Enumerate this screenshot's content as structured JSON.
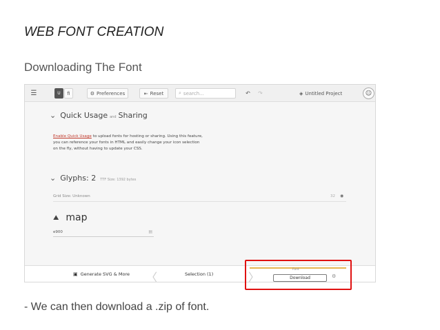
{
  "slide": {
    "title": "WEB FONT CREATION",
    "subtitle": "Downloading The Font",
    "footer": "- We can then download a .zip of font.",
    "highlight_color": "#e01010"
  },
  "toolbar": {
    "menu_icon": "☰",
    "u_label": "U",
    "fi_label": "fi",
    "preferences_icon": "⚙",
    "preferences_label": "Preferences",
    "reset_icon": "⇤",
    "reset_label": "Reset",
    "search_icon": "⌕",
    "search_placeholder": "search...",
    "undo_icon": "↶",
    "redo_icon": "↷",
    "project_icon": "◈",
    "project_label": "Untitled Project",
    "smiley_icon": "☺"
  },
  "quick_usage": {
    "chevron": "⌄",
    "title_part1": "Quick Usage",
    "title_and": "and",
    "title_part2": "Sharing",
    "link_text": "Enable Quick Usage",
    "line1_rest": " to upload fonts for hosting or sharing. Using this feature,",
    "line2": "you can reference your fonts in HTML and easily change your icon selection",
    "line3": "on the fly, without having to update your CSS."
  },
  "glyphs": {
    "chevron": "⌄",
    "title": "Glyphs: 2",
    "ttf_size": "TTF Size: 1392 bytes",
    "grid_label": "Grid Size: Unknown",
    "grid_value": "32",
    "eye_icon": "◉",
    "glyph_icon": "⛰",
    "glyph_name": "map",
    "glyph_code": "e900",
    "copy_icon": "▤"
  },
  "bottombar": {
    "generate_icon": "▣",
    "generate_label": "Generate SVG & More",
    "left_chevron": "〈",
    "selection_label": "Selection (1)",
    "right_chevron": "〉",
    "font_label": "Font",
    "download_label": "Download",
    "gear_icon": "⚙"
  }
}
